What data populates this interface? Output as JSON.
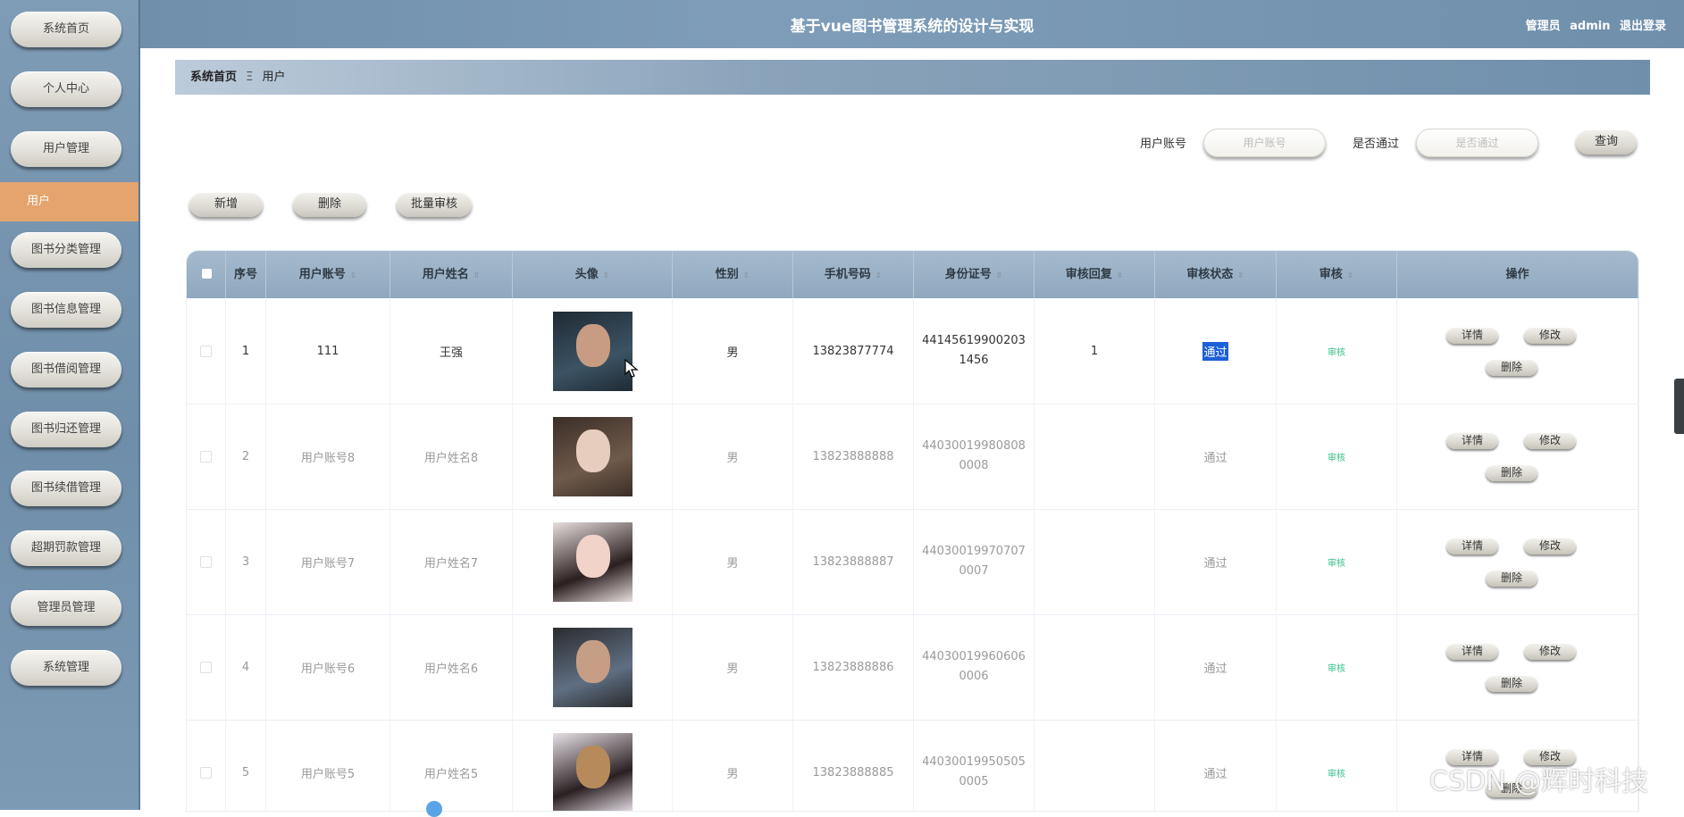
{
  "app": {
    "title": "基于vue图书管理系统的设计与实现",
    "user_role": "管理员",
    "username": "admin",
    "logout": "退出登录"
  },
  "sidebar": {
    "items": [
      {
        "label": "系统首页"
      },
      {
        "label": "个人中心"
      },
      {
        "label": "用户管理"
      },
      {
        "label": "用户",
        "active": true
      },
      {
        "label": "图书分类管理"
      },
      {
        "label": "图书信息管理"
      },
      {
        "label": "图书借阅管理"
      },
      {
        "label": "图书归还管理"
      },
      {
        "label": "图书续借管理"
      },
      {
        "label": "超期罚款管理"
      },
      {
        "label": "管理员管理"
      },
      {
        "label": "系统管理"
      }
    ]
  },
  "breadcrumb": {
    "home": "系统首页",
    "separator": "Ξ",
    "current": "用户"
  },
  "search": {
    "account_label": "用户账号",
    "account_placeholder": "用户账号",
    "account_value": "",
    "pass_label": "是否通过",
    "pass_placeholder": "是否通过",
    "pass_value": "",
    "query_button": "查询"
  },
  "toolbar": {
    "add": "新增",
    "delete": "删除",
    "batch_audit": "批量审核"
  },
  "table": {
    "columns": [
      "",
      "序号",
      "用户账号",
      "用户姓名",
      "头像",
      "性别",
      "手机号码",
      "身份证号",
      "审核回复",
      "审核状态",
      "审核",
      "操作"
    ],
    "sort_glyph": "⇳",
    "rows": [
      {
        "index": "1",
        "account": "111",
        "name": "王强",
        "gender": "男",
        "phone": "13823877774",
        "id_card": "441456199002031456",
        "reply": "1",
        "status": "通过",
        "audit": "审核",
        "avatar_colors": [
          "#1e2a33",
          "#3c5364",
          "#c89c82"
        ]
      },
      {
        "index": "2",
        "account": "用户账号8",
        "name": "用户姓名8",
        "gender": "男",
        "phone": "13823888888",
        "id_card": "440300199808080008",
        "reply": "",
        "status": "通过",
        "audit": "审核",
        "avatar_colors": [
          "#3b2e28",
          "#6f5a4a",
          "#e6cdbd"
        ]
      },
      {
        "index": "3",
        "account": "用户账号7",
        "name": "用户姓名7",
        "gender": "男",
        "phone": "13823888887",
        "id_card": "440300199707070007",
        "reply": "",
        "status": "通过",
        "audit": "审核",
        "avatar_colors": [
          "#e8dede",
          "#2a1e1e",
          "#f1d3ca"
        ]
      },
      {
        "index": "4",
        "account": "用户账号6",
        "name": "用户姓名6",
        "gender": "男",
        "phone": "13823888886",
        "id_card": "440300199606060006",
        "reply": "",
        "status": "通过",
        "audit": "审核",
        "avatar_colors": [
          "#2b2b2e",
          "#5f6f83",
          "#c69e85"
        ]
      },
      {
        "index": "5",
        "account": "用户账号5",
        "name": "用户姓名5",
        "gender": "男",
        "phone": "13823888885",
        "id_card": "440300199505050005",
        "reply": "",
        "status": "通过",
        "audit": "审核",
        "avatar_colors": [
          "#e7e0e6",
          "#2a2022",
          "#b78a5c"
        ]
      }
    ],
    "actions": {
      "detail": "详情",
      "edit": "修改",
      "delete": "删除"
    }
  },
  "watermark": "CSDN @辉时科技",
  "colors": {
    "sidebar_bg": "#7493ae",
    "active_item": "#e5a46d",
    "header_bg": "#7b98b4",
    "audit_link": "#35c08a",
    "selection": "#1d5fd8"
  }
}
